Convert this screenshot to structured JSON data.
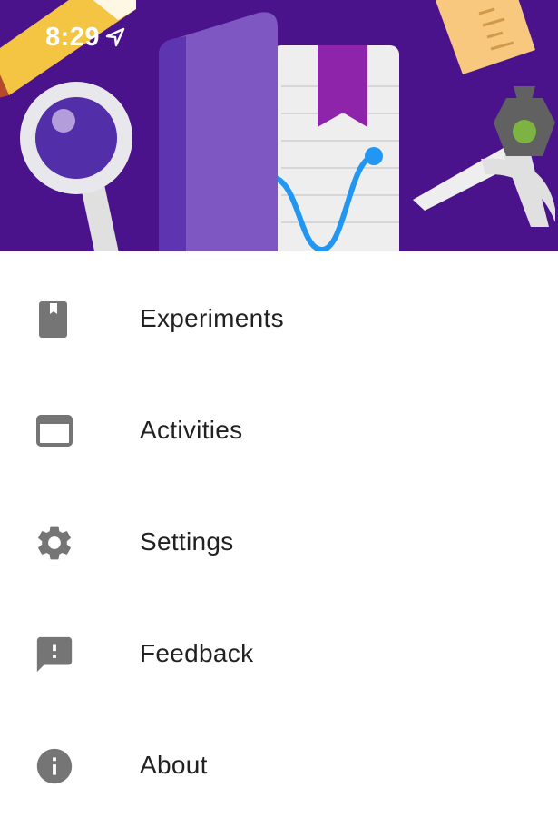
{
  "status_bar": {
    "time": "8:29",
    "location_icon": "location-arrow-icon"
  },
  "header": {
    "background_color": "#4a138c",
    "illustration": "science-journal-header-illustration"
  },
  "menu": {
    "items": [
      {
        "label": "Experiments",
        "icon": "notebook-icon"
      },
      {
        "label": "Activities",
        "icon": "browser-window-icon"
      },
      {
        "label": "Settings",
        "icon": "gear-icon"
      },
      {
        "label": "Feedback",
        "icon": "feedback-icon"
      },
      {
        "label": "About",
        "icon": "info-icon"
      }
    ]
  },
  "colors": {
    "icon": "#757575",
    "text": "#212121"
  }
}
